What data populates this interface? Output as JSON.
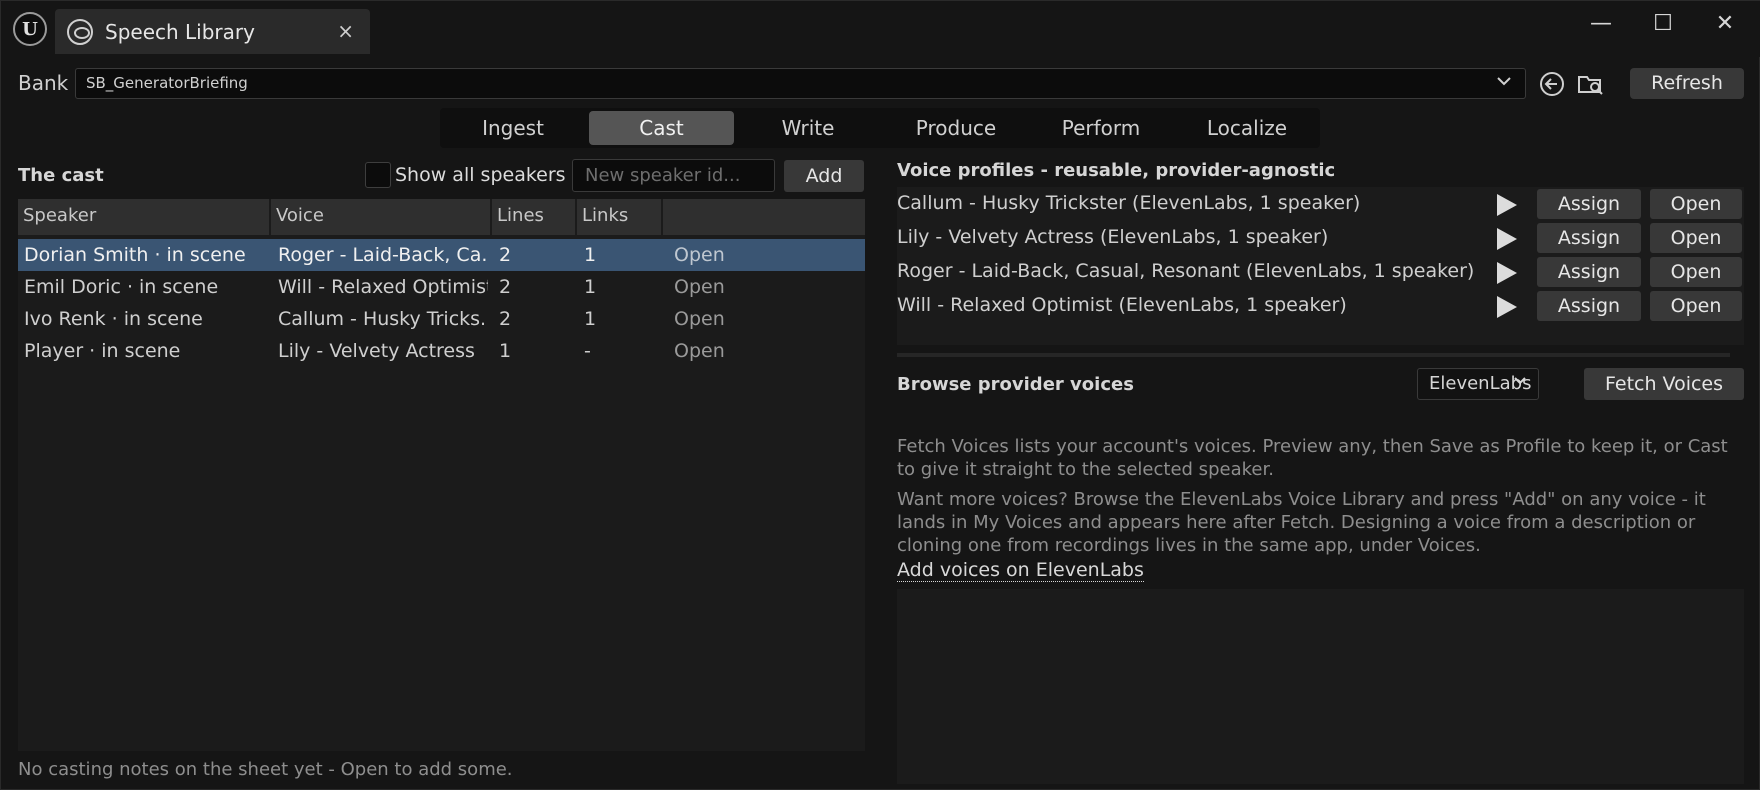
{
  "app": {
    "tab_title": "Speech Library",
    "tab_close": "×",
    "logo_glyph": "U",
    "window_controls": {
      "minimize": "—",
      "maximize": "☐",
      "close": "✕"
    }
  },
  "bank": {
    "label": "Bank",
    "value": "SB_GeneratorBriefing",
    "refresh_label": "Refresh"
  },
  "stages": [
    {
      "label": "Ingest",
      "active": false
    },
    {
      "label": "Cast",
      "active": true
    },
    {
      "label": "Write",
      "active": false
    },
    {
      "label": "Produce",
      "active": false
    },
    {
      "label": "Perform",
      "active": false
    },
    {
      "label": "Localize",
      "active": false
    }
  ],
  "cast": {
    "title": "The cast",
    "show_all_label": "Show all speakers",
    "show_all_checked": false,
    "new_speaker_placeholder": "New speaker id...",
    "add_label": "Add",
    "columns": [
      "Speaker",
      "Voice",
      "Lines",
      "Links",
      ""
    ],
    "rows": [
      {
        "speaker": "Dorian Smith  · in scene",
        "voice": "Roger - Laid-Back, Ca...",
        "lines": "2",
        "links": "1",
        "action": "Open",
        "selected": true
      },
      {
        "speaker": "Emil Doric  · in scene",
        "voice": "Will - Relaxed Optimist",
        "lines": "2",
        "links": "1",
        "action": "Open",
        "selected": false
      },
      {
        "speaker": "Ivo Renk  · in scene",
        "voice": "Callum - Husky Tricks...",
        "lines": "2",
        "links": "1",
        "action": "Open",
        "selected": false
      },
      {
        "speaker": "Player  · in scene",
        "voice": "Lily - Velvety Actress",
        "lines": "1",
        "links": "-",
        "action": "Open",
        "selected": false
      }
    ],
    "notes": "No casting notes on the sheet yet - Open to add some."
  },
  "profiles": {
    "title": "Voice profiles - reusable, provider-agnostic",
    "items": [
      {
        "name": "Callum - Husky Trickster  (ElevenLabs, 1 speaker)",
        "assign": "Assign",
        "open": "Open"
      },
      {
        "name": "Lily - Velvety Actress  (ElevenLabs, 1 speaker)",
        "assign": "Assign",
        "open": "Open"
      },
      {
        "name": "Roger - Laid-Back, Casual, Resonant  (ElevenLabs, 1 speaker)",
        "assign": "Assign",
        "open": "Open"
      },
      {
        "name": "Will - Relaxed Optimist  (ElevenLabs, 1 speaker)",
        "assign": "Assign",
        "open": "Open"
      }
    ]
  },
  "browse": {
    "title": "Browse provider voices",
    "provider": "ElevenLabs",
    "fetch_label": "Fetch Voices",
    "help_1": "Fetch Voices lists your account's voices. Preview any, then Save as Profile to keep it, or Cast to give it straight to the selected speaker.",
    "help_2": "Want more voices? Browse the ElevenLabs Voice Library and press \"Add\" on any voice - it lands in My Voices and appears here after Fetch. Designing a voice from a description or cloning one from recordings lives in the same app, under Voices.",
    "link_label": "Add voices on ElevenLabs"
  },
  "colors": {
    "background": "#151515",
    "panel": "#1b1b1b",
    "selection": "#3a5573",
    "button": "#383838"
  }
}
